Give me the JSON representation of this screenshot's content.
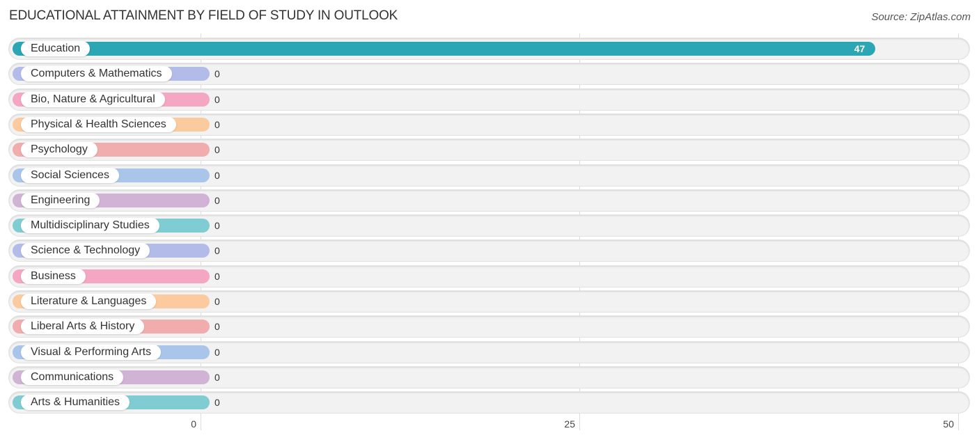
{
  "header": {
    "title": "EDUCATIONAL ATTAINMENT BY FIELD OF STUDY IN OUTLOOK",
    "source": "Source: ZipAtlas.com"
  },
  "chart_data": {
    "type": "bar",
    "orientation": "horizontal",
    "title": "EDUCATIONAL ATTAINMENT BY FIELD OF STUDY IN OUTLOOK",
    "xlabel": "",
    "ylabel": "",
    "xlim": [
      0,
      50
    ],
    "ticks": [
      0,
      25,
      50
    ],
    "tick_labels": [
      "0",
      "25",
      "50"
    ],
    "grid": true,
    "categories": [
      "Education",
      "Computers & Mathematics",
      "Bio, Nature & Agricultural",
      "Physical & Health Sciences",
      "Psychology",
      "Social Sciences",
      "Engineering",
      "Multidisciplinary Studies",
      "Science & Technology",
      "Business",
      "Literature & Languages",
      "Liberal Arts & History",
      "Visual & Performing Arts",
      "Communications",
      "Arts & Humanities"
    ],
    "values": [
      47,
      0,
      0,
      0,
      0,
      0,
      0,
      0,
      0,
      0,
      0,
      0,
      0,
      0,
      0
    ],
    "value_labels": [
      "47",
      "0",
      "0",
      "0",
      "0",
      "0",
      "0",
      "0",
      "0",
      "0",
      "0",
      "0",
      "0",
      "0",
      "0"
    ],
    "colors": [
      "#2aa6b4",
      "#b3bce8",
      "#f4a6c3",
      "#fbcb9f",
      "#f1adad",
      "#a9c6ea",
      "#d1b3d6",
      "#7fcdd2",
      "#b3bce8",
      "#f4a6c3",
      "#fbcb9f",
      "#f1adad",
      "#a9c6ea",
      "#d1b3d6",
      "#7fcdd2"
    ]
  }
}
